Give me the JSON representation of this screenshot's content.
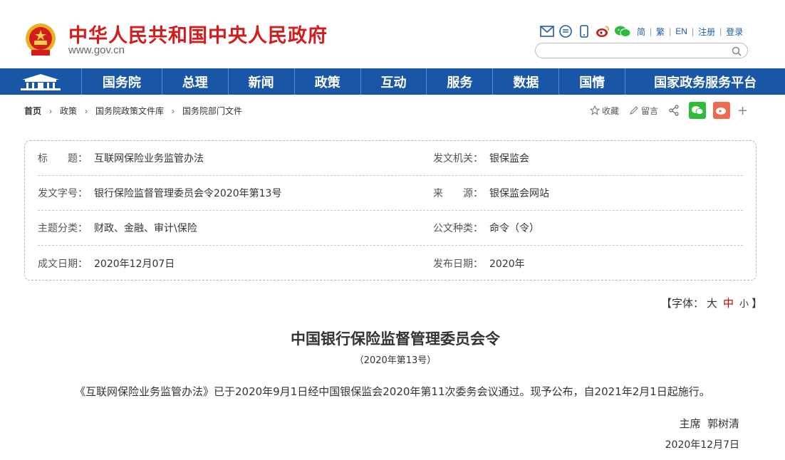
{
  "header": {
    "site_title": "中华人民共和国中央人民政府",
    "site_domain": "www.gov.cn",
    "tool_icons": [
      "mail-icon",
      "message-icon",
      "mobile-icon",
      "weibo-icon",
      "wechat-icon"
    ],
    "lang_links": [
      "简",
      "繁",
      "EN",
      "注册",
      "登录"
    ],
    "search_placeholder": ""
  },
  "nav": {
    "items": [
      "国务院",
      "总理",
      "新闻",
      "政策",
      "互动",
      "服务",
      "数据",
      "国情",
      "国家政务服务平台"
    ]
  },
  "breadcrumb": {
    "items": [
      "首页",
      "政策",
      "国务院政策文件库",
      "国务院部门文件"
    ]
  },
  "actions": {
    "favorite": "收藏",
    "comment": "留言"
  },
  "info": {
    "title_label": "标　　题：",
    "title_value": "互联网保险业务监管办法",
    "issuer_label": "发文机关：",
    "issuer_value": "银保监会",
    "doc_no_label": "发文字号：",
    "doc_no_value": "银行保险监督管理委员会令2020年第13号",
    "source_label": "来　　源：",
    "source_value": "银保监会网站",
    "category_label": "主题分类：",
    "category_value": "财政、金融、审计\\保险",
    "doc_type_label": "公文种类：",
    "doc_type_value": "命令（令）",
    "written_date_label": "成文日期：",
    "written_date_value": "2020年12月07日",
    "publish_date_label": "发布日期：",
    "publish_date_value": "2020年"
  },
  "font_size": {
    "prefix": "【字体：",
    "large": "大",
    "medium": "中",
    "small": "小",
    "suffix": "】"
  },
  "document": {
    "title": "中国银行保险监督管理委员会令",
    "subtitle": "（2020年第13号）",
    "body": "《互联网保险业务监管办法》已于2020年9月1日经中国银保监会2020年第11次委务会议通过。现予公布，自2021年2月1日起施行。",
    "signature": "主席  郭树清",
    "date": "2020年12月7日"
  },
  "colors": {
    "brand_red": "#d51c1c",
    "nav_blue": "#1a56a6",
    "wechat_green": "#2dbb3a",
    "weibo_orange": "#f06a4f"
  }
}
